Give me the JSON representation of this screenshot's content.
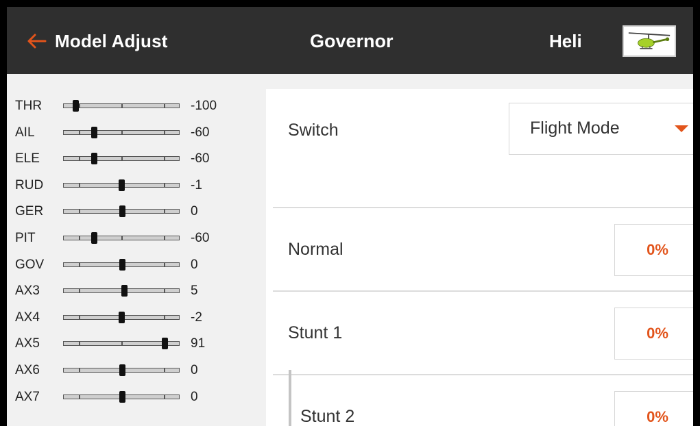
{
  "header": {
    "back_label": "Model Adjust",
    "title": "Governor",
    "model_name": "Heli",
    "accent_color": "#e2541b"
  },
  "channels": [
    {
      "name": "THR",
      "value": "-100"
    },
    {
      "name": "AIL",
      "value": "-60"
    },
    {
      "name": "ELE",
      "value": "-60"
    },
    {
      "name": "RUD",
      "value": "-1"
    },
    {
      "name": "GER",
      "value": "0"
    },
    {
      "name": "PIT",
      "value": "-60"
    },
    {
      "name": "GOV",
      "value": "0"
    },
    {
      "name": "AX3",
      "value": "5"
    },
    {
      "name": "AX4",
      "value": "-2"
    },
    {
      "name": "AX5",
      "value": "91"
    },
    {
      "name": "AX6",
      "value": "0"
    },
    {
      "name": "AX7",
      "value": "0"
    }
  ],
  "governor": {
    "switch_label": "Switch",
    "switch_value": "Flight Mode",
    "rows": [
      {
        "label": "Normal",
        "value": "0%"
      },
      {
        "label": "Stunt 1",
        "value": "0%"
      },
      {
        "label": "Stunt 2",
        "value": "0%"
      }
    ]
  },
  "icons": [
    "back-arrow-icon",
    "dropdown-arrow-icon",
    "helicopter-thumbnail"
  ]
}
